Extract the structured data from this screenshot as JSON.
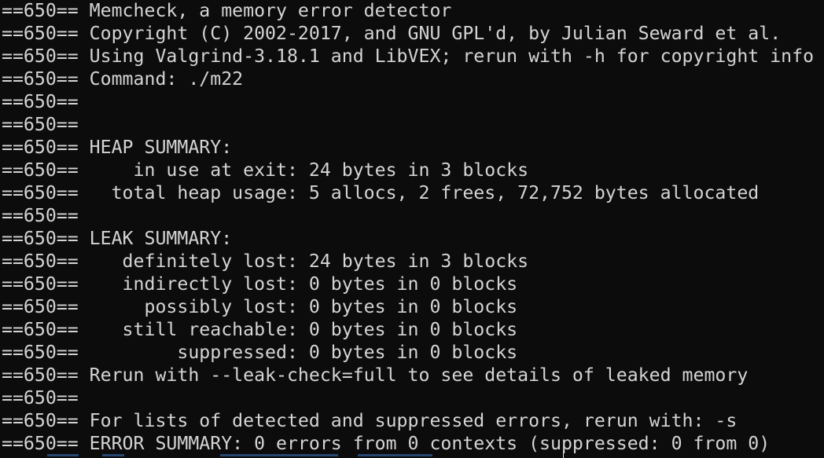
{
  "terminal": {
    "lines": [
      "==650== Memcheck, a memory error detector",
      "==650== Copyright (C) 2002-2017, and GNU GPL'd, by Julian Seward et al.",
      "==650== Using Valgrind-3.18.1 and LibVEX; rerun with -h for copyright info",
      "==650== Command: ./m22",
      "==650==",
      "==650==",
      "==650== HEAP SUMMARY:",
      "==650==     in use at exit: 24 bytes in 3 blocks",
      "==650==   total heap usage: 5 allocs, 2 frees, 72,752 bytes allocated",
      "==650==",
      "==650== LEAK SUMMARY:",
      "==650==    definitely lost: 24 bytes in 3 blocks",
      "==650==    indirectly lost: 0 bytes in 0 blocks",
      "==650==      possibly lost: 0 bytes in 0 blocks",
      "==650==    still reachable: 0 bytes in 0 blocks",
      "==650==         suppressed: 0 bytes in 0 blocks",
      "==650== Rerun with --leak-check=full to see details of leaked memory",
      "==650==",
      "==650== For lists of detected and suppressed errors, rerun with: -s",
      "==650== ERROR SUMMARY: 0 errors from 0 contexts (suppressed: 0 from 0)"
    ],
    "colors": {
      "background": "#0c0c0c",
      "foreground": "#d4d4d4",
      "cutoff_accent": "#3d78c4"
    }
  }
}
